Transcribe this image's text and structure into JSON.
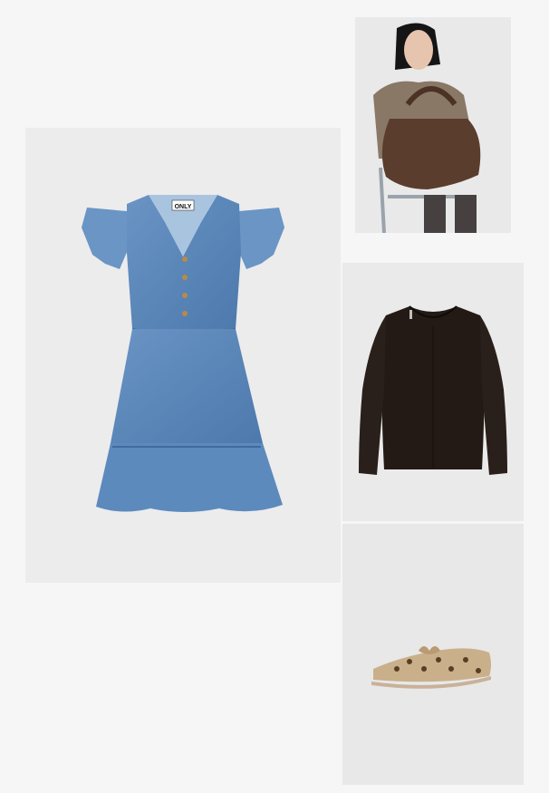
{
  "outfit": {
    "items": [
      {
        "id": "dress",
        "category": "denim-dress",
        "brand_label": "ONLY",
        "color": "#5a86b8"
      },
      {
        "id": "model",
        "category": "model-with-handbag",
        "color": "#5a3d2d"
      },
      {
        "id": "sweater",
        "category": "sweater",
        "color": "#231a16"
      },
      {
        "id": "shoe",
        "category": "leopard-loafer",
        "color": "#c9b08a"
      }
    ]
  }
}
